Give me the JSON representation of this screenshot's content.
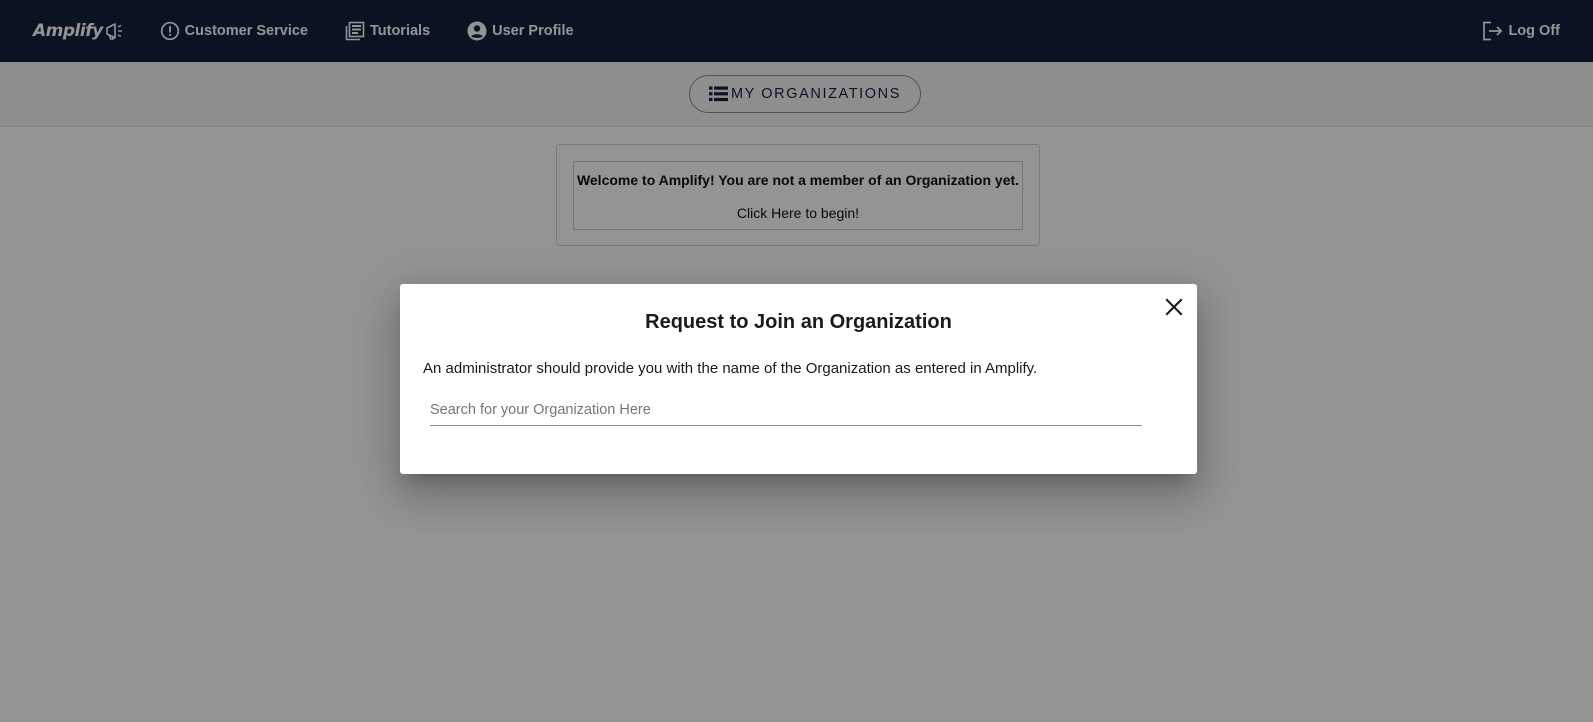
{
  "header": {
    "logo_text": "Amplify",
    "nav": [
      {
        "label": "Customer Service",
        "icon": "alert-circle-icon"
      },
      {
        "label": "Tutorials",
        "icon": "newspaper-icon"
      },
      {
        "label": "User Profile",
        "icon": "account-circle-icon"
      }
    ],
    "logoff_label": "Log Off"
  },
  "subbar": {
    "my_orgs_label": "MY ORGANIZATIONS"
  },
  "welcome": {
    "title": "Welcome to Amplify! You are not a member of an Organization yet.",
    "link": "Click Here to begin!"
  },
  "modal": {
    "title": "Request to Join an Organization",
    "description": "An administrator should provide you with the name of the Organization as entered in Amplify.",
    "search_placeholder": "Search for your Organization Here",
    "search_value": ""
  },
  "colors": {
    "header_bg": "#13203c",
    "accent_text": "#13203c"
  }
}
